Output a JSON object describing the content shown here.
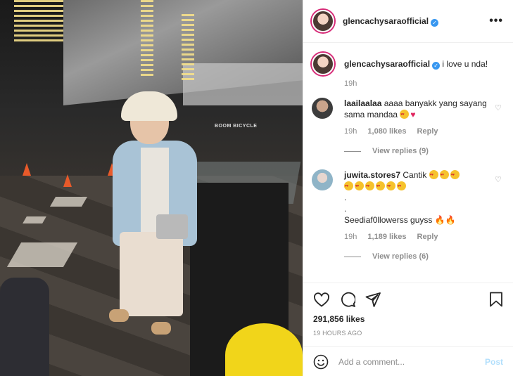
{
  "post": {
    "username": "glencachysaraofficial",
    "verified_icon": "verified-badge-icon",
    "more_icon": "more-options-icon",
    "caption": "i love u nda!",
    "caption_time": "19h",
    "likes": "291,856 likes",
    "time_ago": "19 HOURS AGO"
  },
  "photo": {
    "sign_text": "BOOM BICYCLE"
  },
  "comments": [
    {
      "username": "laailaalaa",
      "text": "aaaa banyakk yang sayang sama mandaa",
      "time": "19h",
      "likes": "1,080 likes",
      "reply_label": "Reply",
      "view_replies": "View replies (9)"
    },
    {
      "username": "juwita.stores7",
      "text_line1": "Cantik",
      "dot1": ".",
      "dot2": ".",
      "text_line2": "Seediaf0llowerss guyss",
      "time": "19h",
      "likes": "1,189 likes",
      "reply_label": "Reply",
      "view_replies": "View replies (6)"
    }
  ],
  "actions": {
    "like_icon": "heart-icon",
    "comment_icon": "comment-icon",
    "share_icon": "share-icon",
    "save_icon": "bookmark-icon"
  },
  "add_comment": {
    "emoji_icon": "emoji-icon",
    "placeholder": "Add a comment...",
    "post_label": "Post"
  },
  "colors": {
    "accent": "#3897f0",
    "story_ring": "#d62976",
    "post_disabled": "#b2dffc"
  }
}
